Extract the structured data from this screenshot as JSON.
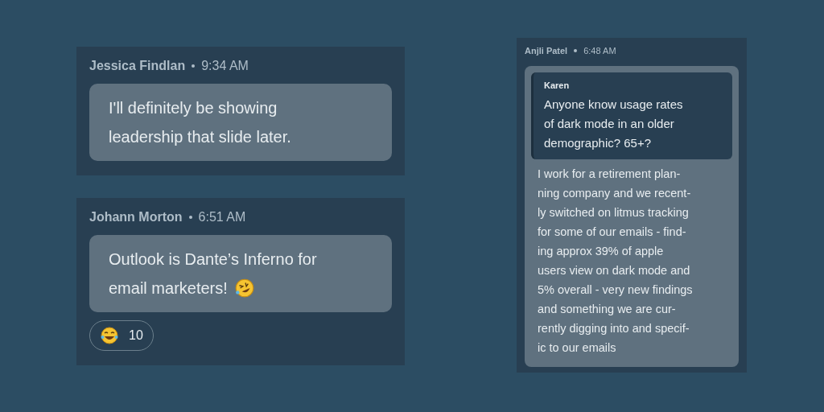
{
  "messages": [
    {
      "author": "Jessica Findlan",
      "time": "9:34 AM",
      "lines": [
        "I'll definitely be showing",
        "leadership that slide later."
      ]
    },
    {
      "author": "Johann Morton",
      "time": "6:51 AM",
      "lines": [
        "Outlook is Dante’s Inferno for",
        "email marketers!"
      ],
      "reaction": {
        "count": "10"
      }
    }
  ],
  "thread": {
    "author": "Anjli Patel",
    "time": "6:48 AM",
    "quote": {
      "author": "Karen",
      "lines": [
        "Anyone know usage rates",
        "of dark mode in an older",
        "demographic? 65+?"
      ]
    },
    "lines": [
      "I work for a retirement plan-",
      "ning company and we recent-",
      "ly switched on litmus tracking",
      "for some of our emails - find-",
      "ing approx 39% of apple",
      "users view on dark mode and",
      "5% overall - very new findings",
      "and something we are cur-",
      "rently digging into and specif-",
      "ic to our emails"
    ]
  }
}
